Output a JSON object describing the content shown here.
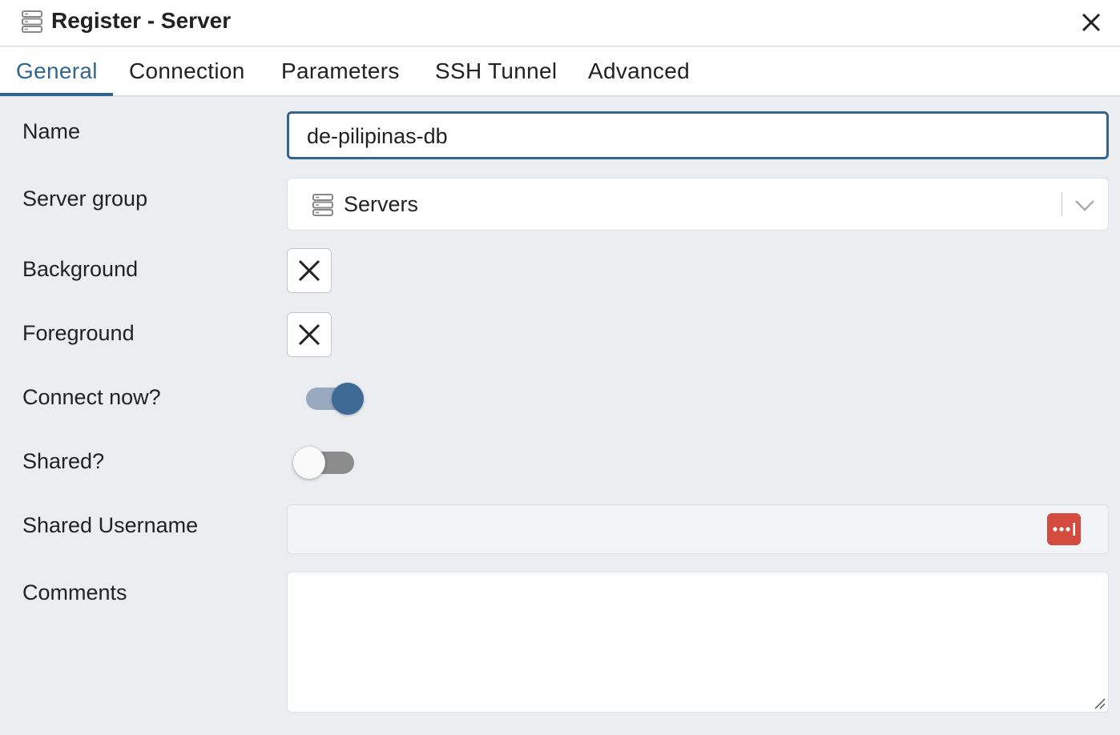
{
  "dialog": {
    "title": "Register - Server",
    "icon": "server-icon",
    "close_icon": "close-icon"
  },
  "tabs": [
    {
      "label": "General",
      "active": true
    },
    {
      "label": "Connection",
      "active": false
    },
    {
      "label": "Parameters",
      "active": false
    },
    {
      "label": "SSH Tunnel",
      "active": false
    },
    {
      "label": "Advanced",
      "active": false
    }
  ],
  "form": {
    "name": {
      "label": "Name",
      "value": "de-pilipinas-db"
    },
    "server_group": {
      "label": "Server group",
      "value": "Servers",
      "icon": "server-icon"
    },
    "background": {
      "label": "Background",
      "icon": "no-color-icon"
    },
    "foreground": {
      "label": "Foreground",
      "icon": "no-color-icon"
    },
    "connect_now": {
      "label": "Connect now?",
      "on": true
    },
    "shared": {
      "label": "Shared?",
      "on": false
    },
    "shared_username": {
      "label": "Shared Username",
      "value": "",
      "icon": "password-manager-icon"
    },
    "comments": {
      "label": "Comments",
      "value": ""
    }
  },
  "colors": {
    "accent": "#326690",
    "toggle_on_track": "#98a9c0",
    "toggle_off_track": "#8c8c8c",
    "password_badge": "#d34a3f",
    "background": "#ebedf1"
  }
}
